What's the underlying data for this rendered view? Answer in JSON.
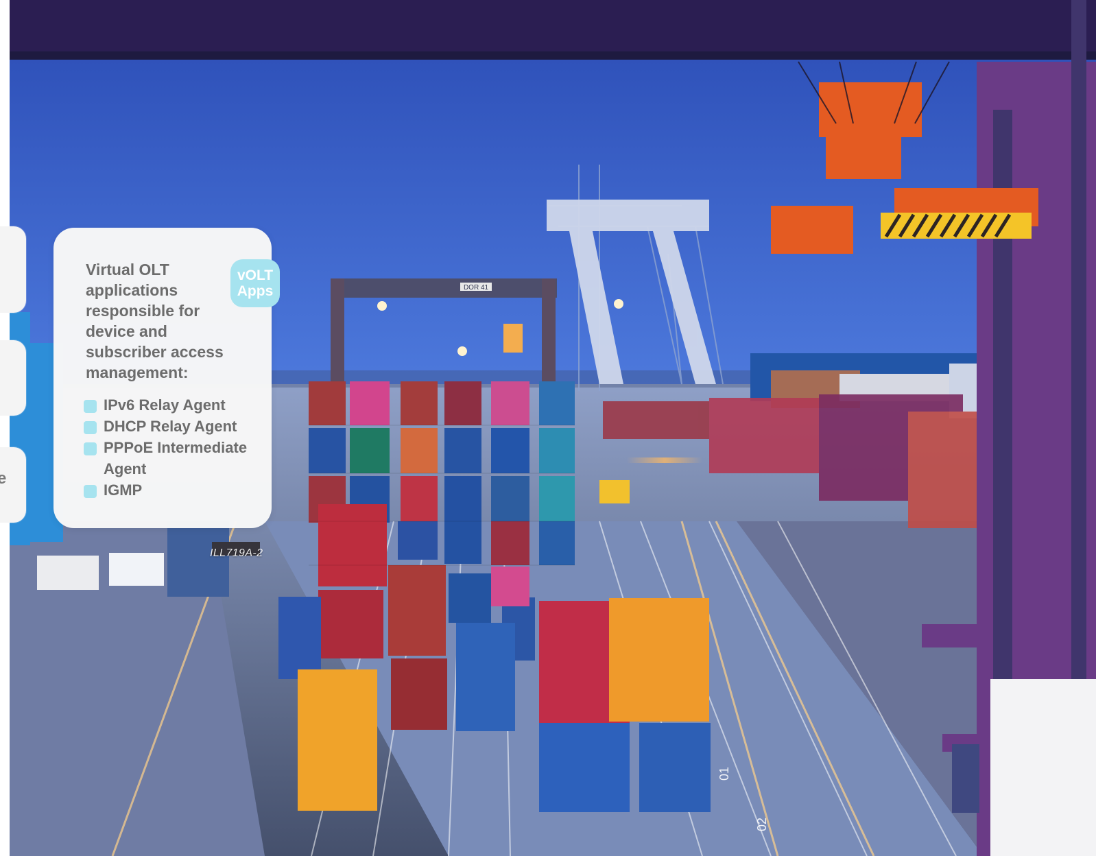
{
  "info_card": {
    "badge_line_1": "vOLT",
    "badge_line_2": "Apps",
    "title": "Virtual OLT applications responsible for device and subscriber access management:",
    "items": [
      {
        "label": "IPv6 Relay Agent"
      },
      {
        "label": "DHCP Relay Agent"
      },
      {
        "label": "PPPoE Intermediate Agent"
      },
      {
        "label": "IGMP"
      }
    ]
  },
  "side_cards": {
    "partial_letter": "e"
  },
  "background_photo": {
    "crane_sign": "DOR 41",
    "container_code": "ILL719A-2",
    "road_marks": [
      "01",
      "02"
    ]
  },
  "colors": {
    "card_background": "#f7f7f7",
    "accent": "#a6e3ef",
    "text": "#6c6c6c"
  },
  "icons": {
    "bullet": "square-bullet-icon"
  }
}
